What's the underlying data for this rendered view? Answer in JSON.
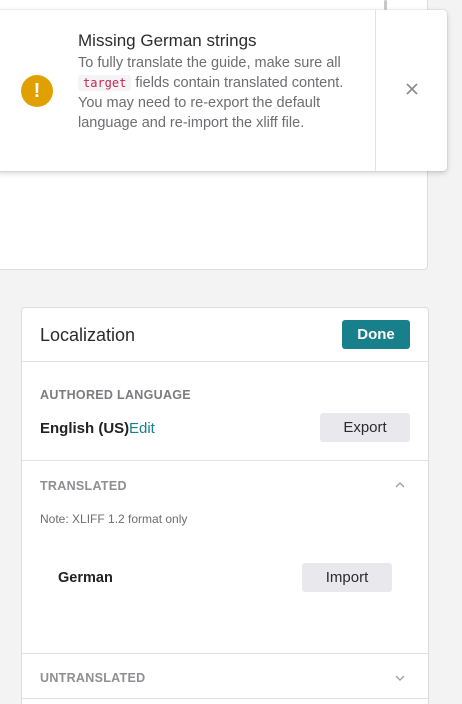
{
  "toast": {
    "title": "Missing German strings",
    "body_before": "To fully translate the guide, make sure all ",
    "code": "target",
    "body_after": " fields contain translated content. You may need to re-export the default language and re-import the xliff file.",
    "warning_glyph": "!",
    "close_glyph": "✕",
    "warning_color": "#e0a100"
  },
  "localization": {
    "title": "Localization",
    "done_label": "Done",
    "authored": {
      "label": "AUTHORED LANGUAGE",
      "language": "English (US)",
      "edit_label": "Edit",
      "export_label": "Export"
    },
    "translated": {
      "label": "TRANSLATED",
      "note": "Note: XLIFF 1.2 format only",
      "languages": [
        {
          "name": "German",
          "action_label": "Import"
        }
      ]
    },
    "untranslated": {
      "label": "UNTRANSLATED"
    }
  },
  "icons": {
    "warning": "warning-icon",
    "close": "close-icon",
    "chevron_up": "chevron-up-icon",
    "chevron_down": "chevron-down-icon"
  },
  "colors": {
    "accent": "#17808b",
    "warning": "#e0a100"
  }
}
